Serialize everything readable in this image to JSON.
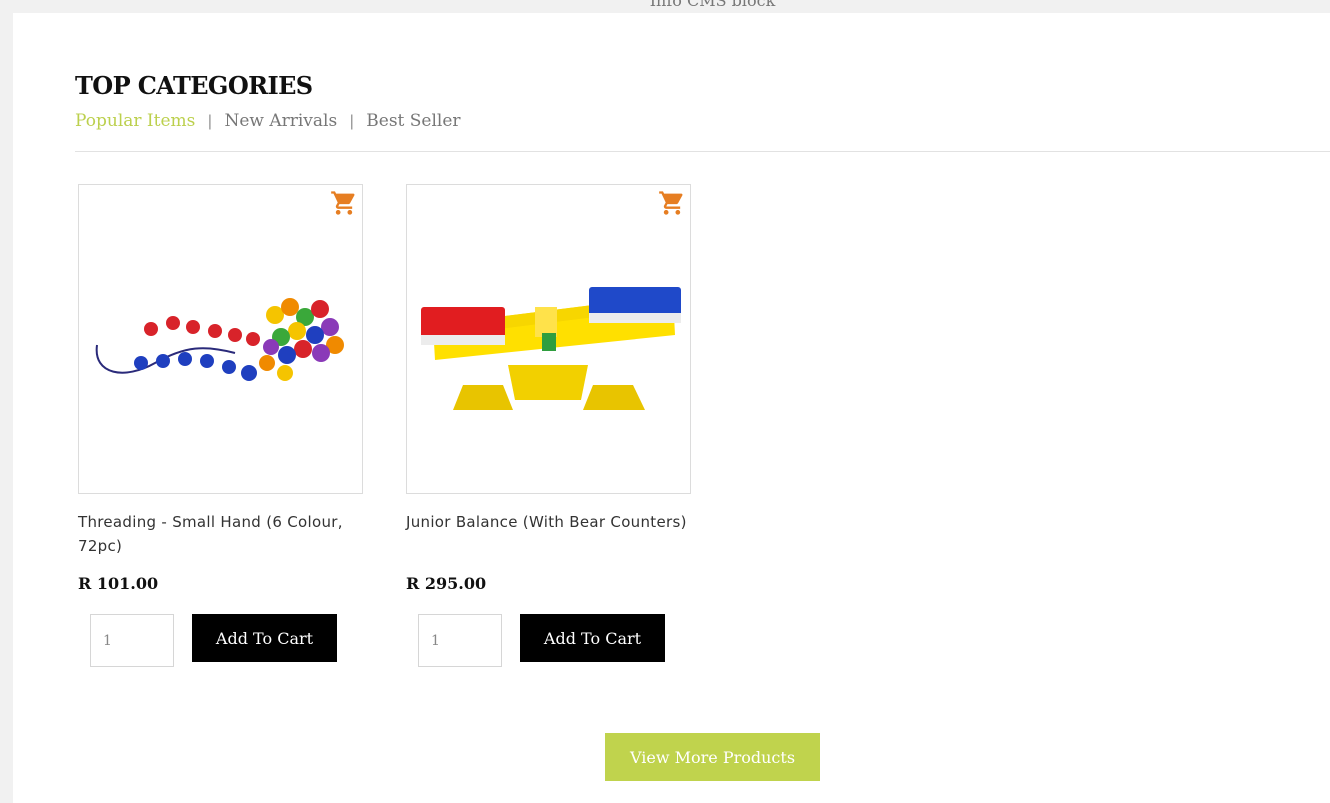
{
  "top_note": "Info CMS block",
  "section": {
    "heading": "TOP CATEGORIES",
    "tabs": [
      {
        "label": "Popular Items",
        "active": true
      },
      {
        "label": "New Arrivals",
        "active": false
      },
      {
        "label": "Best Seller",
        "active": false
      }
    ],
    "separator": "|"
  },
  "products": [
    {
      "title": "Threading - Small Hand (6 Colour, 72pc)",
      "price": "R 101.00",
      "quantity": "1",
      "add_label": "Add To Cart",
      "cart_icon": "shopping-cart-icon"
    },
    {
      "title": "Junior Balance (With Bear Counters)",
      "price": "R 295.00",
      "quantity": "1",
      "add_label": "Add To Cart",
      "cart_icon": "shopping-cart-icon"
    }
  ],
  "view_more_label": "View More Products",
  "colors": {
    "accent": "#c0d34d",
    "cart_icon": "#e67e22",
    "button": "#000000"
  }
}
